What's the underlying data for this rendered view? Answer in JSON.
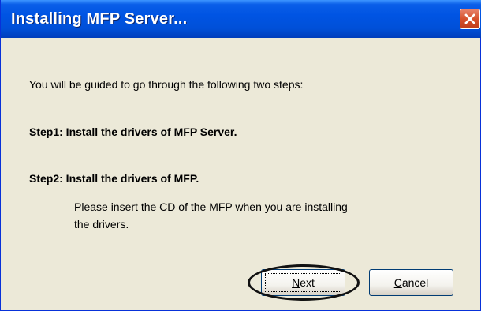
{
  "window": {
    "title": "Installing MFP Server..."
  },
  "content": {
    "intro": "You will be guided to go through the following two steps:",
    "step1": "Step1: Install the drivers of MFP Server.",
    "step2": "Step2: Install the drivers of MFP.",
    "note_line1": "Please insert the CD of the MFP when you are installing",
    "note_line2": "the drivers."
  },
  "buttons": {
    "next": {
      "mnemonic": "N",
      "rest": "ext"
    },
    "cancel": {
      "mnemonic": "C",
      "rest": "ancel"
    }
  },
  "colors": {
    "titlebar": "#0054e3",
    "dialog_bg": "#ece9d8",
    "close_button": "#d6512d"
  }
}
